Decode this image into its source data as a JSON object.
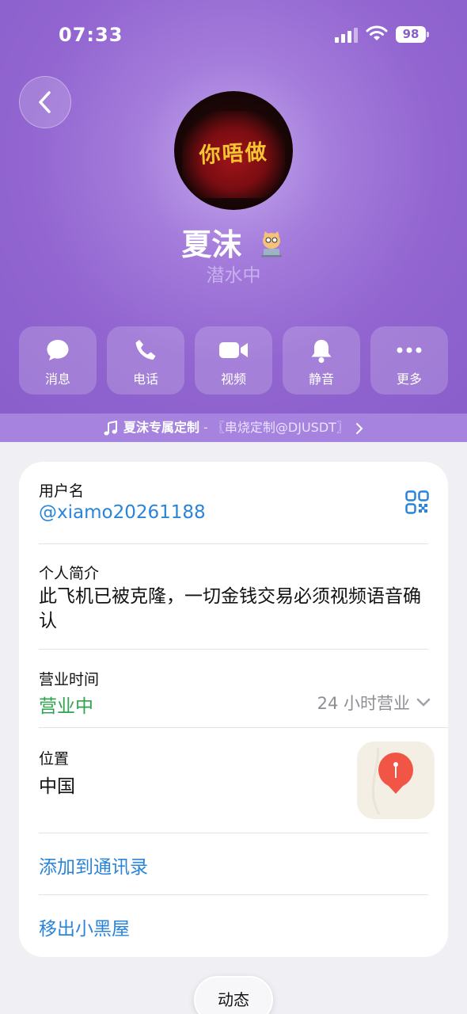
{
  "status_bar": {
    "time": "07:33",
    "battery": "98"
  },
  "profile": {
    "avatar_text": "你唔做",
    "name": "夏沫",
    "status": "潜水中"
  },
  "actions": [
    {
      "label": "消息",
      "icon": "message-icon"
    },
    {
      "label": "电话",
      "icon": "phone-icon"
    },
    {
      "label": "视频",
      "icon": "video-icon"
    },
    {
      "label": "静音",
      "icon": "bell-icon"
    },
    {
      "label": "更多",
      "icon": "more-icon"
    }
  ],
  "music": {
    "title": "夏沫专属定制",
    "separator": " - ",
    "subtitle": "〖串烧定制@DJUSDT〗"
  },
  "info": {
    "username_label": "用户名",
    "username": "@xiamo20261188",
    "bio_label": "个人简介",
    "bio": "此飞机已被克隆，一切金钱交易必须视频语音确认",
    "hours_label": "营业时间",
    "hours_status": "营业中",
    "hours_detail": "24 小时营业",
    "location_label": "位置",
    "location": "中国",
    "add_contact": "添加到通讯录",
    "unblock": "移出小黑屋"
  },
  "footer": {
    "moments": "动态"
  },
  "colors": {
    "header": "#8a5fcc",
    "link": "#2a84d8",
    "open_green": "#2ea44f"
  }
}
